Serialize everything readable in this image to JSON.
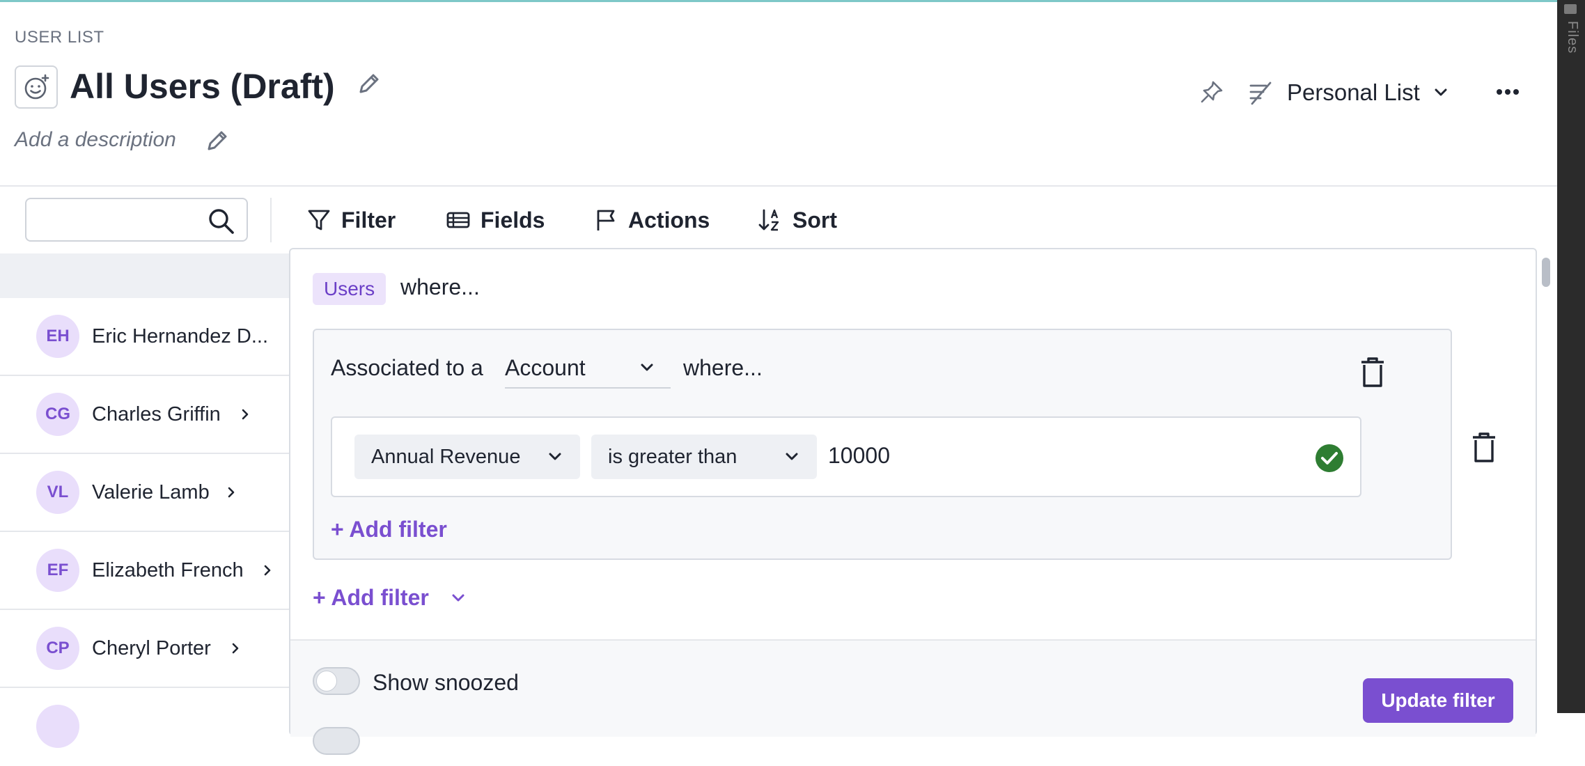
{
  "header": {
    "breadcrumb": "USER LIST",
    "title": "All Users (Draft)",
    "description_placeholder": "Add a description",
    "list_type": "Personal List"
  },
  "toolbar": {
    "search_value": "",
    "filter_label": "Filter",
    "fields_label": "Fields",
    "actions_label": "Actions",
    "sort_label": "Sort"
  },
  "users": [
    {
      "initials": "EH",
      "name": "Eric Hernandez D..."
    },
    {
      "initials": "CG",
      "name": "Charles Griffin"
    },
    {
      "initials": "VL",
      "name": "Valerie Lamb"
    },
    {
      "initials": "EF",
      "name": "Elizabeth French"
    },
    {
      "initials": "CP",
      "name": "Cheryl Porter"
    }
  ],
  "filter": {
    "entity_chip": "Users",
    "where_text": "where...",
    "association_prefix": "Associated to a",
    "association_object": "Account",
    "association_where": "where...",
    "condition": {
      "field": "Annual Revenue",
      "operator": "is greater than",
      "value": "10000"
    },
    "add_filter_inner": "+ Add filter",
    "add_filter_outer": "+ Add filter",
    "show_snoozed_label": "Show snoozed",
    "show_snoozed_on": false,
    "update_button": "Update filter"
  },
  "side_panel": {
    "files_label": "Files"
  },
  "colors": {
    "accent": "#7a4fd0",
    "chip_bg": "#ece3fb",
    "success": "#2e7d32",
    "top_accent": "#7ec8c8"
  }
}
